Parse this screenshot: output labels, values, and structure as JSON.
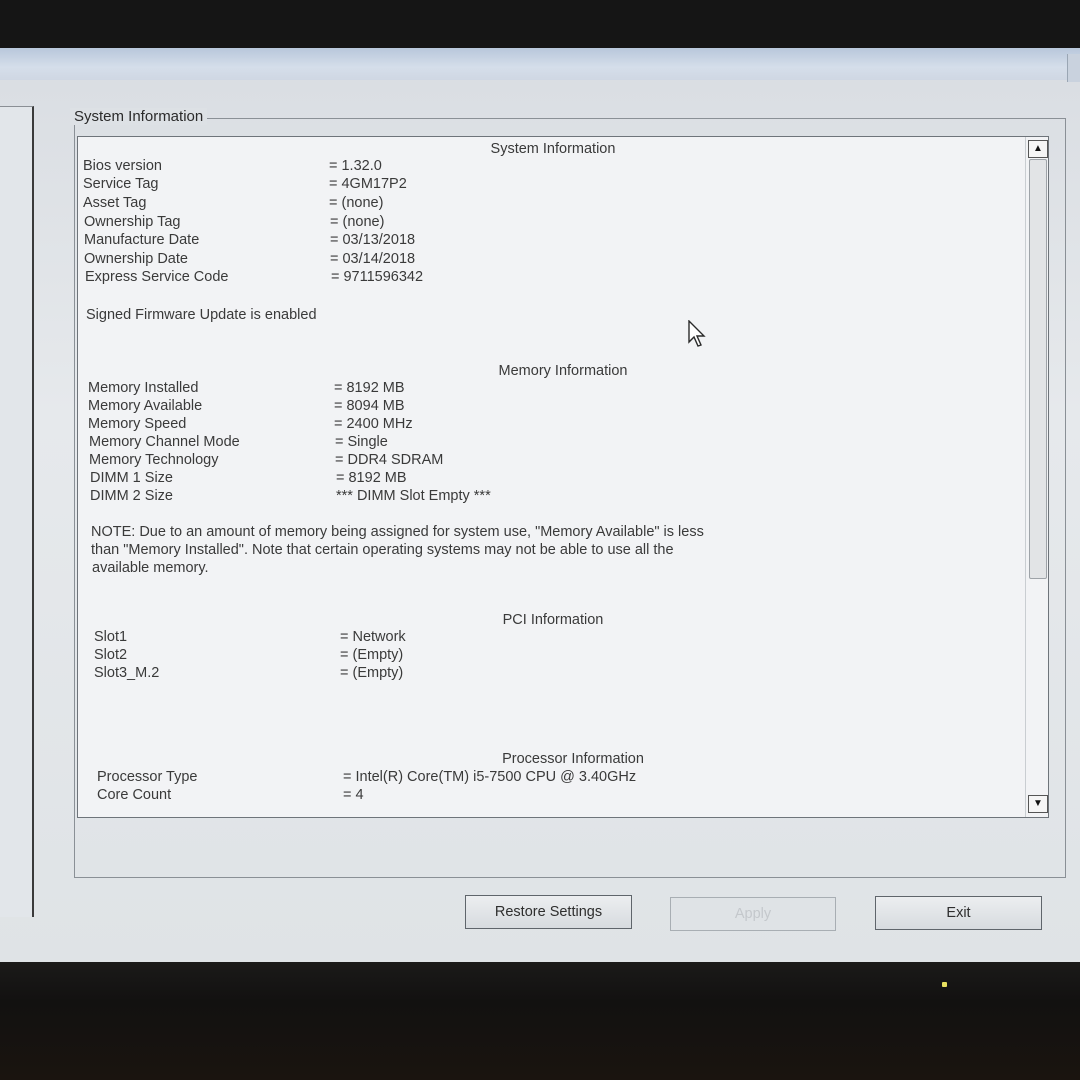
{
  "group_title": "System Information",
  "system_info": {
    "title": "System Information",
    "rows": [
      {
        "label": "Bios version",
        "value": "= 1.32.0"
      },
      {
        "label": "Service Tag",
        "value": "= 4GM17P2"
      },
      {
        "label": "Asset Tag",
        "value": "= (none)"
      },
      {
        "label": "Ownership Tag",
        "value": "= (none)"
      },
      {
        "label": "Manufacture Date",
        "value": "= 03/13/2018"
      },
      {
        "label": "Ownership Date",
        "value": "= 03/14/2018"
      },
      {
        "label": "Express Service Code",
        "value": "= 9711596342"
      }
    ],
    "status": "Signed Firmware Update is enabled"
  },
  "memory_info": {
    "title": "Memory Information",
    "rows": [
      {
        "label": "Memory Installed",
        "value": "= 8192 MB"
      },
      {
        "label": "Memory Available",
        "value": "= 8094 MB"
      },
      {
        "label": "Memory Speed",
        "value": "= 2400 MHz"
      },
      {
        "label": "Memory Channel Mode",
        "value": "= Single"
      },
      {
        "label": "Memory Technology",
        "value": "= DDR4 SDRAM"
      },
      {
        "label": "DIMM 1 Size",
        "value": "= 8192 MB"
      },
      {
        "label": "DIMM 2 Size",
        "value": "*** DIMM Slot Empty ***"
      }
    ],
    "note_lines": [
      "NOTE: Due to an amount of memory being assigned for system use, \"Memory Available\" is less",
      "than \"Memory Installed\". Note that certain operating systems may not be able to use all the",
      "available memory."
    ]
  },
  "pci_info": {
    "title": "PCI Information",
    "rows": [
      {
        "label": "Slot1",
        "value": "= Network"
      },
      {
        "label": "Slot2",
        "value": "= (Empty)"
      },
      {
        "label": "Slot3_M.2",
        "value": "= (Empty)"
      }
    ]
  },
  "processor_info": {
    "title": "Processor Information",
    "rows": [
      {
        "label": "Processor Type",
        "value": "= Intel(R) Core(TM) i5-7500 CPU @ 3.40GHz"
      },
      {
        "label": "Core Count",
        "value": "= 4"
      }
    ]
  },
  "buttons": {
    "restore": "Restore Settings",
    "apply": "Apply",
    "exit": "Exit"
  },
  "icons": {
    "scroll_up": "scroll-up-arrow-icon",
    "scroll_down": "scroll-down-arrow-icon",
    "cursor": "mouse-pointer-icon"
  }
}
